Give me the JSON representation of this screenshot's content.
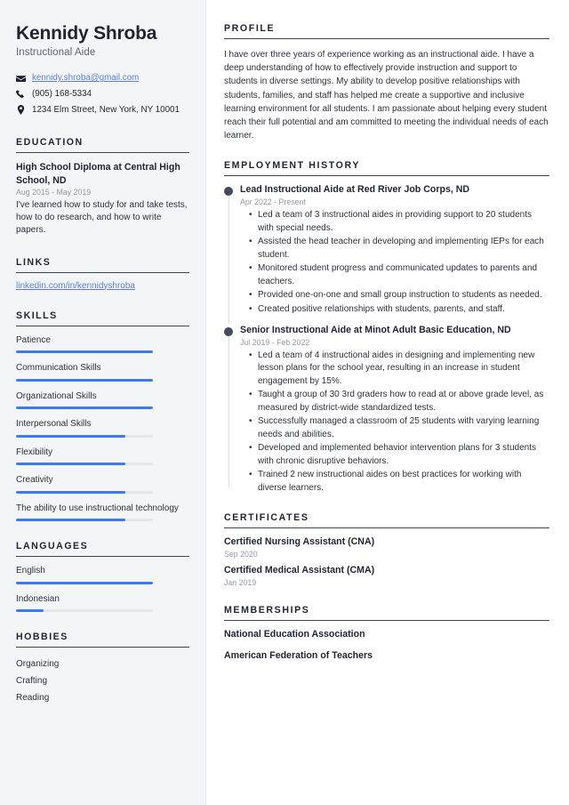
{
  "theme": {
    "accent": "#3b7af5",
    "link": "#5b7fd6",
    "heading": "#1f2430",
    "muted": "#93999f",
    "sidebar_bg": "#f4f5f7",
    "bar_track": "#e4e6ea",
    "timeline_dot": "#454b5c"
  },
  "header": {
    "name": "Kennidy Shroba",
    "job_title": "Instructional Aide"
  },
  "contact": {
    "email": "kennidy.shroba@gmail.com",
    "phone": "(905) 168-5334",
    "address": "1234 Elm Street, New York, NY 10001",
    "email_icon": "envelope-icon",
    "phone_icon": "phone-icon",
    "address_icon": "location-pin-icon"
  },
  "education": {
    "heading": "EDUCATION",
    "items": [
      {
        "title": "High School Diploma at Central High School, ND",
        "date": "Aug 2015 - May 2019",
        "description": "I've learned how to study for and take tests, how to do research, and how to write papers."
      }
    ]
  },
  "links": {
    "heading": "LINKS",
    "items": [
      {
        "label": "linkedin.com/in/kennidyshroba"
      }
    ]
  },
  "skills": {
    "heading": "SKILLS",
    "items": [
      {
        "label": "Patience",
        "level": 100
      },
      {
        "label": "Communication Skills",
        "level": 100
      },
      {
        "label": "Organizational Skills",
        "level": 100
      },
      {
        "label": "Interpersonal Skills",
        "level": 80
      },
      {
        "label": "Flexibility",
        "level": 80
      },
      {
        "label": "Creativity",
        "level": 80
      },
      {
        "label": "The ability to use instructional technology",
        "level": 80
      }
    ]
  },
  "languages": {
    "heading": "LANGUAGES",
    "items": [
      {
        "label": "English",
        "level": 100
      },
      {
        "label": "Indonesian",
        "level": 20
      }
    ]
  },
  "hobbies": {
    "heading": "HOBBIES",
    "items": [
      {
        "label": "Organizing"
      },
      {
        "label": "Crafting"
      },
      {
        "label": "Reading"
      }
    ]
  },
  "profile": {
    "heading": "PROFILE",
    "text": "I have over three years of experience working as an instructional aide. I have a deep understanding of how to effectively provide instruction and support to students in diverse settings. My ability to develop positive relationships with students, families, and staff has helped me create a supportive and inclusive learning environment for all students. I am passionate about helping every student reach their full potential and am committed to meeting the individual needs of each learner."
  },
  "employment": {
    "heading": "EMPLOYMENT HISTORY",
    "jobs": [
      {
        "title": "Lead Instructional Aide at Red River Job Corps, ND",
        "date": "Apr 2022 - Present",
        "bullets": [
          "Led a team of 3 instructional aides in providing support to 20 students with special needs.",
          "Assisted the head teacher in developing and implementing IEPs for each student.",
          "Monitored student progress and communicated updates to parents and teachers.",
          "Provided one-on-one and small group instruction to students as needed.",
          "Created positive relationships with students, parents, and staff."
        ]
      },
      {
        "title": "Senior Instructional Aide at Minot Adult Basic Education, ND",
        "date": "Jul 2019 - Feb 2022",
        "bullets": [
          "Led a team of 4 instructional aides in designing and implementing new lesson plans for the school year, resulting in an increase in student engagement by 15%.",
          "Taught a group of 30 3rd graders how to read at or above grade level, as measured by district-wide standardized tests.",
          "Successfully managed a classroom of 25 students with varying learning needs and abilities.",
          "Developed and implemented behavior intervention plans for 3 students with chronic disruptive behaviors.",
          "Trained 2 new instructional aides on best practices for working with diverse learners."
        ]
      }
    ]
  },
  "certificates": {
    "heading": "CERTIFICATES",
    "items": [
      {
        "name": "Certified Nursing Assistant (CNA)",
        "date": "Sep 2020"
      },
      {
        "name": "Certified Medical Assistant (CMA)",
        "date": "Jan 2019"
      }
    ]
  },
  "memberships": {
    "heading": "MEMBERSHIPS",
    "items": [
      {
        "name": "National Education Association"
      },
      {
        "name": "American Federation of Teachers"
      }
    ]
  }
}
